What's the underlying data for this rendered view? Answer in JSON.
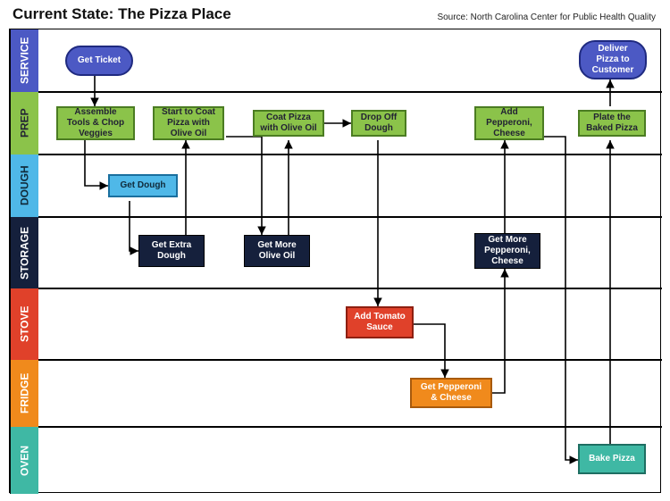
{
  "title": "Current State: The Pizza Place",
  "source": "Source: North Carolina Center for Public Health Quality",
  "chart_data": {
    "type": "swimlane-flowchart",
    "lanes": [
      {
        "id": "service",
        "label": "SERVICE",
        "color": "#4c59c4"
      },
      {
        "id": "prep",
        "label": "PREP",
        "color": "#8bc34a"
      },
      {
        "id": "dough",
        "label": "DOUGH",
        "color": "#4fb8e8"
      },
      {
        "id": "storage",
        "label": "STORAGE",
        "color": "#15203c"
      },
      {
        "id": "stove",
        "label": "STOVE",
        "color": "#e0412a"
      },
      {
        "id": "fridge",
        "label": "FRIDGE",
        "color": "#f08a1c"
      },
      {
        "id": "oven",
        "label": "OVEN",
        "color": "#3fb8a4"
      }
    ],
    "nodes": [
      {
        "id": "get_ticket",
        "lane": "service",
        "label": "Get Ticket",
        "shape": "pill"
      },
      {
        "id": "deliver",
        "lane": "service",
        "label": "Deliver Pizza to Customer",
        "shape": "pill"
      },
      {
        "id": "assemble",
        "lane": "prep",
        "label": "Assemble Tools & Chop Veggies"
      },
      {
        "id": "start_coat",
        "lane": "prep",
        "label": "Start to Coat Pizza with Olive Oil"
      },
      {
        "id": "coat_oil",
        "lane": "prep",
        "label": "Coat Pizza with Olive Oil"
      },
      {
        "id": "drop_dough",
        "lane": "prep",
        "label": "Drop Off Dough"
      },
      {
        "id": "add_pep_cheese",
        "lane": "prep",
        "label": "Add Pepperoni, Cheese"
      },
      {
        "id": "plate_pizza",
        "lane": "prep",
        "label": "Plate the Baked Pizza"
      },
      {
        "id": "get_dough",
        "lane": "dough",
        "label": "Get Dough"
      },
      {
        "id": "extra_dough",
        "lane": "storage",
        "label": "Get Extra Dough"
      },
      {
        "id": "more_oil",
        "lane": "storage",
        "label": "Get More Olive Oil"
      },
      {
        "id": "more_pep_cheese",
        "lane": "storage",
        "label": "Get More Pepperoni, Cheese"
      },
      {
        "id": "tomato_sauce",
        "lane": "stove",
        "label": "Add Tomato Sauce"
      },
      {
        "id": "get_pep_cheese",
        "lane": "fridge",
        "label": "Get Pepperoni & Cheese"
      },
      {
        "id": "bake_pizza",
        "lane": "oven",
        "label": "Bake Pizza"
      }
    ],
    "edges": [
      [
        "get_ticket",
        "assemble"
      ],
      [
        "assemble",
        "get_dough"
      ],
      [
        "get_dough",
        "extra_dough"
      ],
      [
        "extra_dough",
        "start_coat"
      ],
      [
        "start_coat",
        "more_oil"
      ],
      [
        "more_oil",
        "coat_oil"
      ],
      [
        "coat_oil",
        "drop_dough"
      ],
      [
        "drop_dough",
        "tomato_sauce"
      ],
      [
        "tomato_sauce",
        "get_pep_cheese"
      ],
      [
        "get_pep_cheese",
        "more_pep_cheese"
      ],
      [
        "more_pep_cheese",
        "add_pep_cheese"
      ],
      [
        "add_pep_cheese",
        "bake_pizza"
      ],
      [
        "bake_pizza",
        "plate_pizza"
      ],
      [
        "plate_pizza",
        "deliver"
      ]
    ]
  }
}
